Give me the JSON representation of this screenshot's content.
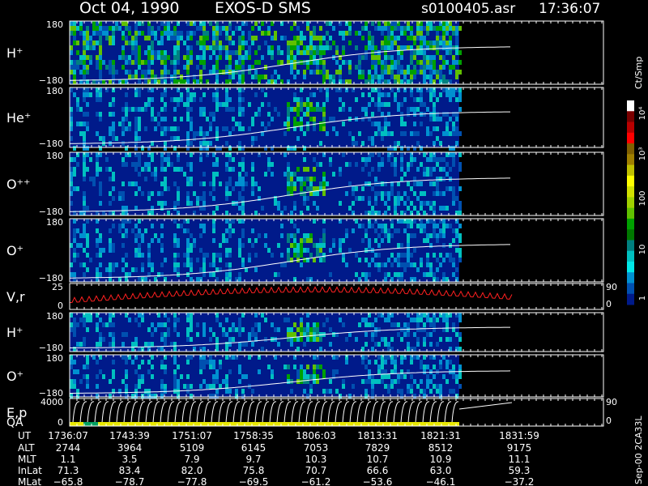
{
  "header": {
    "date": "Oct 04, 1990",
    "instrument": "EXOS-D SMS",
    "file": "s0100405.asr",
    "time": "17:36:07"
  },
  "colorbar": {
    "label": "Ct/Smp",
    "ticks": [
      "10⁴",
      "10³",
      "100",
      "10",
      "1"
    ],
    "colors": [
      "#ffffff",
      "#7a0000",
      "#b80000",
      "#ff0000",
      "#806000",
      "#a08000",
      "#c0c000",
      "#ffff00",
      "#d0e000",
      "#a0d000",
      "#60c000",
      "#00a000",
      "#007800",
      "#008080",
      "#00c0c0",
      "#00e8e8",
      "#0090d0",
      "#0050b0",
      "#001a8a"
    ]
  },
  "panels": [
    {
      "label": "H⁺",
      "ymax": "180",
      "ymin": "−180"
    },
    {
      "label": "He⁺",
      "ymax": "180",
      "ymin": "−180"
    },
    {
      "label": "O⁺⁺",
      "ymax": "180",
      "ymin": "−180"
    },
    {
      "label": "O⁺",
      "ymax": "180",
      "ymin": "−180"
    },
    {
      "label": "V,r",
      "ymax": "25",
      "ymin": "0",
      "rmax": "90",
      "rmin": "0"
    },
    {
      "label": "H⁺",
      "ymax": "180",
      "ymin": "−180"
    },
    {
      "label": "O⁺",
      "ymax": "180",
      "ymin": "−180"
    },
    {
      "label": "E,p",
      "label2": "QA",
      "ymax": "4000",
      "ymin": "0",
      "rmax": "90",
      "rmin": "0"
    }
  ],
  "footer": {
    "rows": [
      {
        "name": "UT",
        "values": [
          "1736:07",
          "1743:39",
          "1751:07",
          "1758:35",
          "1806:03",
          "1813:31",
          "1821:31",
          "1831:59"
        ]
      },
      {
        "name": "ALT",
        "values": [
          "2744",
          "3964",
          "5109",
          "6145",
          "7053",
          "7829",
          "8512",
          "9175"
        ]
      },
      {
        "name": "MLT",
        "values": [
          "1.1",
          "3.5",
          "7.9",
          "9.7",
          "10.3",
          "10.7",
          "10.9",
          "11.1"
        ]
      },
      {
        "name": "InLat",
        "values": [
          "71.3",
          "83.4",
          "82.0",
          "75.8",
          "70.7",
          "66.6",
          "63.0",
          "59.3"
        ]
      },
      {
        "name": "MLat",
        "values": [
          "−65.8",
          "−78.7",
          "−77.8",
          "−69.5",
          "−61.2",
          "−53.6",
          "−46.1",
          "−37.2"
        ]
      }
    ],
    "side_note": "Sep-00 2CA33L"
  },
  "chart_data": {
    "type": "heatmap",
    "title": "Oct 04, 1990   EXOS-D SMS",
    "x_ticks": [
      "1736:07",
      "1743:39",
      "1751:07",
      "1758:35",
      "1806:03",
      "1813:31",
      "1821:31",
      "1831:59"
    ],
    "data_end": "1821:31",
    "colorbar_range": [
      1,
      10000
    ],
    "colorbar_scale": "log",
    "series": [
      {
        "name": "H⁺",
        "ylim": [
          -180,
          180
        ]
      },
      {
        "name": "He⁺",
        "ylim": [
          -180,
          180
        ]
      },
      {
        "name": "O⁺⁺",
        "ylim": [
          -180,
          180
        ]
      },
      {
        "name": "O⁺",
        "ylim": [
          -180,
          180
        ]
      },
      {
        "name": "V,r",
        "ylim": [
          0,
          25
        ],
        "y2lim": [
          0,
          90
        ]
      },
      {
        "name": "H⁺",
        "ylim": [
          -180,
          180
        ]
      },
      {
        "name": "O⁺",
        "ylim": [
          -180,
          180
        ]
      },
      {
        "name": "E,p",
        "ylim": [
          0,
          4000
        ],
        "y2lim": [
          0,
          90
        ]
      }
    ]
  }
}
